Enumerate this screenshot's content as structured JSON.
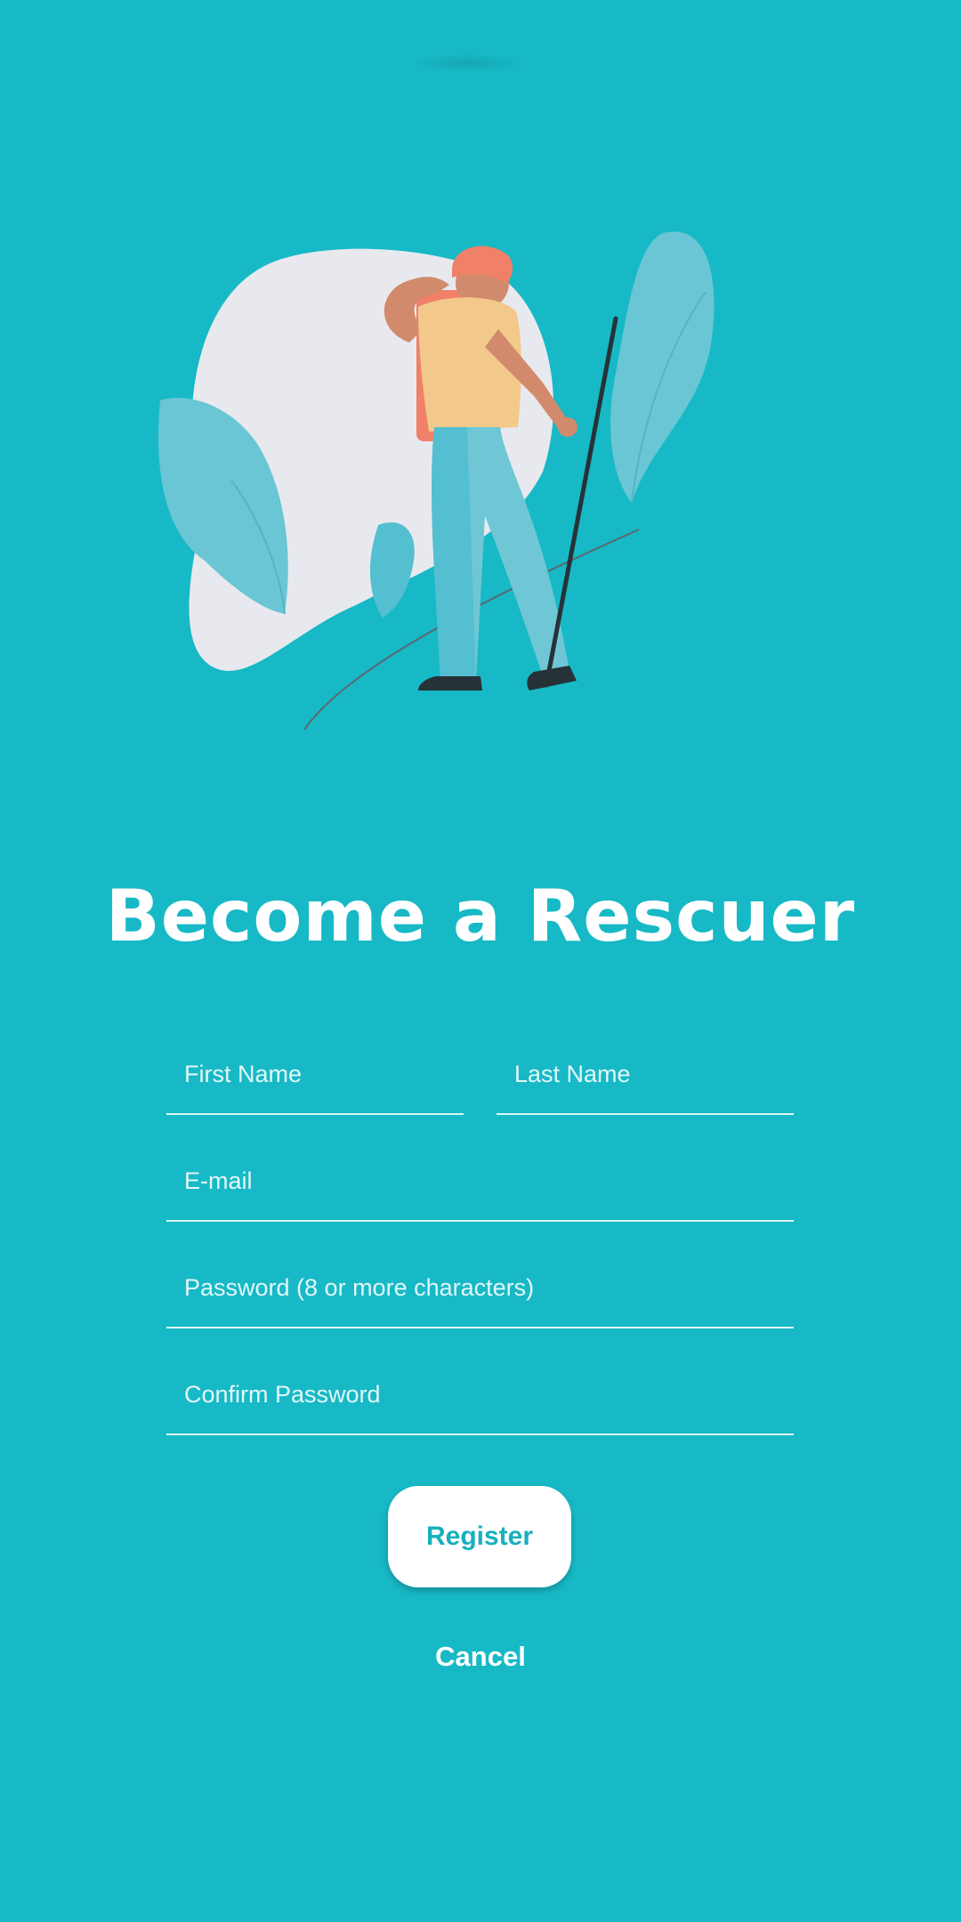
{
  "screen": {
    "title": "Become a Rescuer"
  },
  "form": {
    "first_name": {
      "placeholder": "First Name",
      "value": ""
    },
    "last_name": {
      "placeholder": "Last Name",
      "value": ""
    },
    "email": {
      "placeholder": "E-mail",
      "value": ""
    },
    "password": {
      "placeholder": "Password (8 or more characters)",
      "value": ""
    },
    "confirm_password": {
      "placeholder": "Confirm Password",
      "value": ""
    }
  },
  "actions": {
    "register_label": "Register",
    "cancel_label": "Cancel"
  },
  "theme": {
    "background": "#17b9c6",
    "button_background": "#ffffff",
    "button_text": "#17b0bd",
    "text": "#ffffff"
  },
  "illustration": {
    "icon": "hiker-with-stick-illustration"
  }
}
